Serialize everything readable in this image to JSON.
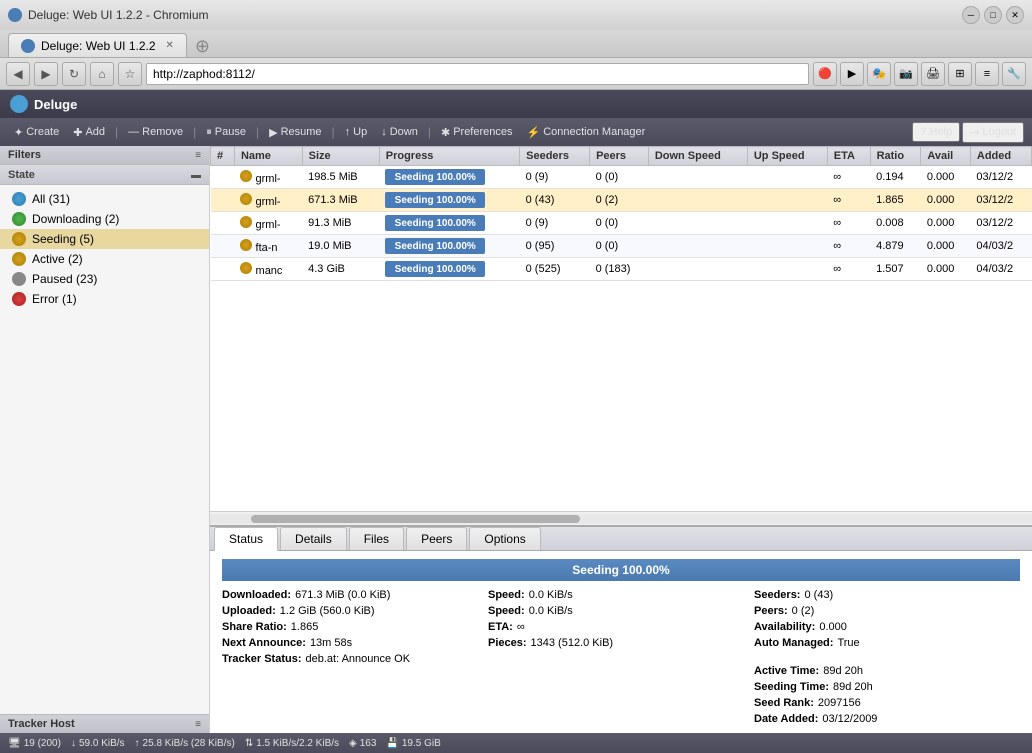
{
  "browser": {
    "titlebar": "Deluge: Web UI 1.2.2 - Chromium",
    "tab_label": "Deluge: Web UI 1.2.2",
    "address": "http://zaphod:8112/"
  },
  "app": {
    "title": "Deluge",
    "toolbar": {
      "create": "Create",
      "add": "Add",
      "remove": "Remove",
      "pause": "Pause",
      "resume": "Resume",
      "up": "Up",
      "down": "Down",
      "preferences": "Preferences",
      "connection_manager": "Connection Manager",
      "help": "Help",
      "logout": "Logout"
    },
    "sidebar": {
      "filters_label": "Filters",
      "state_label": "State",
      "tracker_label": "Tracker Host",
      "items": [
        {
          "label": "All (31)",
          "type": "all"
        },
        {
          "label": "Downloading (2)",
          "type": "downloading"
        },
        {
          "label": "Seeding (5)",
          "type": "seeding",
          "active": true
        },
        {
          "label": "Active (2)",
          "type": "active"
        },
        {
          "label": "Paused (23)",
          "type": "paused"
        },
        {
          "label": "Error (1)",
          "type": "error"
        }
      ]
    },
    "table": {
      "columns": [
        "#",
        "Name",
        "Size",
        "Progress",
        "Seeders",
        "Peers",
        "Down Speed",
        "Up Speed",
        "ETA",
        "Ratio",
        "Avail",
        "Added"
      ],
      "rows": [
        {
          "num": "",
          "name": "grml-",
          "size": "198.5 MiB",
          "progress": "Seeding 100.00%",
          "seeders": "0 (9)",
          "peers": "0 (0)",
          "down_speed": "",
          "up_speed": "",
          "eta": "∞",
          "ratio": "0.194",
          "avail": "0.000",
          "added": "03/12/2",
          "selected": false
        },
        {
          "num": "",
          "name": "grml-",
          "size": "671.3 MiB",
          "progress": "Seeding 100.00%",
          "seeders": "0 (43)",
          "peers": "0 (2)",
          "down_speed": "",
          "up_speed": "",
          "eta": "∞",
          "ratio": "1.865",
          "avail": "0.000",
          "added": "03/12/2",
          "selected": true
        },
        {
          "num": "",
          "name": "grml-",
          "size": "91.3 MiB",
          "progress": "Seeding 100.00%",
          "seeders": "0 (9)",
          "peers": "0 (0)",
          "down_speed": "",
          "up_speed": "",
          "eta": "∞",
          "ratio": "0.008",
          "avail": "0.000",
          "added": "03/12/2",
          "selected": false
        },
        {
          "num": "",
          "name": "fta-n",
          "size": "19.0 MiB",
          "progress": "Seeding 100.00%",
          "seeders": "0 (95)",
          "peers": "0 (0)",
          "down_speed": "",
          "up_speed": "",
          "eta": "∞",
          "ratio": "4.879",
          "avail": "0.000",
          "added": "04/03/2",
          "selected": false
        },
        {
          "num": "",
          "name": "manc",
          "size": "4.3 GiB",
          "progress": "Seeding 100.00%",
          "seeders": "0 (525)",
          "peers": "0 (183)",
          "down_speed": "",
          "up_speed": "",
          "eta": "∞",
          "ratio": "1.507",
          "avail": "0.000",
          "added": "04/03/2",
          "selected": false
        }
      ]
    },
    "bottom_tabs": [
      "Status",
      "Details",
      "Files",
      "Peers",
      "Options"
    ],
    "active_tab": "Status",
    "status_panel": {
      "header": "Seeding 100.00%",
      "downloaded_label": "Downloaded:",
      "downloaded_value": "671.3 MiB (0.0 KiB)",
      "uploaded_label": "Uploaded:",
      "uploaded_value": "1.2 GiB (560.0 KiB)",
      "share_ratio_label": "Share Ratio:",
      "share_ratio_value": "1.865",
      "next_announce_label": "Next Announce:",
      "next_announce_value": "13m 58s",
      "tracker_status_label": "Tracker Status:",
      "tracker_status_value": "deb.at: Announce OK",
      "speed_dl_label": "Speed:",
      "speed_dl_value": "0.0 KiB/s",
      "speed_ul_label": "Speed:",
      "speed_ul_value": "0.0 KiB/s",
      "eta_label": "ETA:",
      "eta_value": "∞",
      "pieces_label": "Pieces:",
      "pieces_value": "1343 (512.0 KiB)",
      "seeders_label": "Seeders:",
      "seeders_value": "0 (43)",
      "peers_label": "Peers:",
      "peers_value": "0 (2)",
      "availability_label": "Availability:",
      "availability_value": "0.000",
      "auto_managed_label": "Auto Managed:",
      "auto_managed_value": "True",
      "active_time_label": "Active Time:",
      "active_time_value": "89d 20h",
      "seeding_time_label": "Seeding Time:",
      "seeding_time_value": "89d 20h",
      "seed_rank_label": "Seed Rank:",
      "seed_rank_value": "2097156",
      "date_added_label": "Date Added:",
      "date_added_value": "03/12/2009"
    },
    "statusbar": {
      "connections": "19 (200)",
      "dl_speed": "59.0 KiB/s",
      "ul_speed": "25.8 KiB/s (28 KiB/s)",
      "protocol": "1.5 KiB/s/2.2 KiB/s",
      "nodes": "163",
      "disk": "19.5 GiB"
    }
  }
}
